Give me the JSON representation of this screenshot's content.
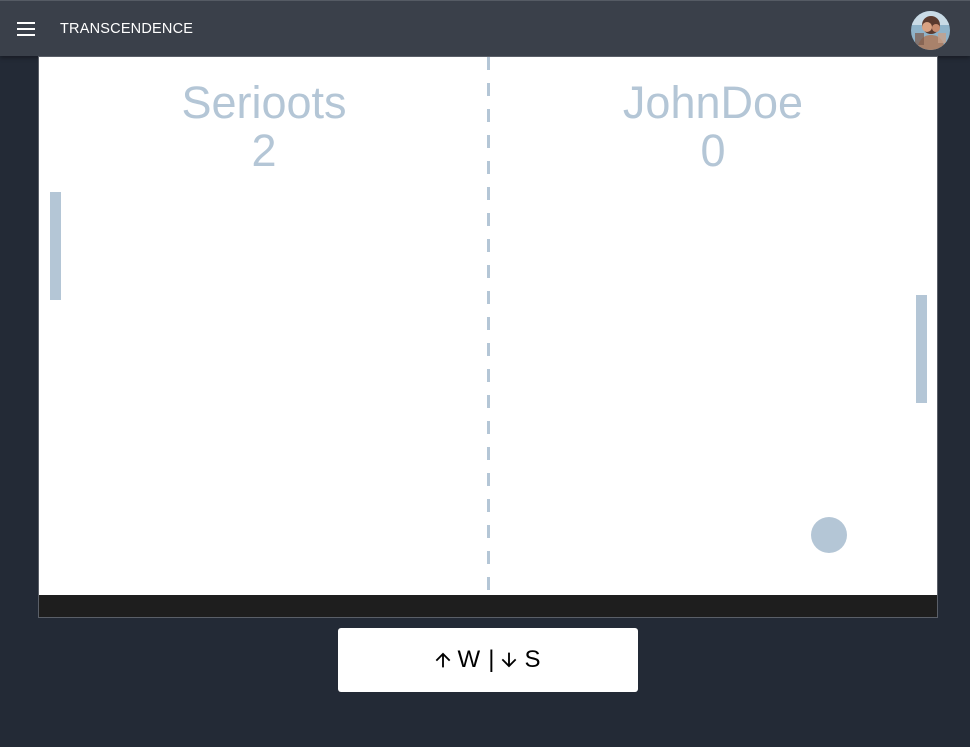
{
  "app": {
    "title": "TRANSCENDENCE",
    "menu_icon": "hamburger-menu-icon",
    "avatar_icon": "user-avatar"
  },
  "game": {
    "players": [
      {
        "name": "Serioots",
        "score": "2"
      },
      {
        "name": "JohnDoe",
        "score": "0"
      }
    ]
  },
  "controls": {
    "up_icon": "arrow-up-icon",
    "up_key": "W",
    "separator": "|",
    "down_icon": "arrow-down-icon",
    "down_key": "S"
  },
  "colors": {
    "page_background": "#232a36",
    "app_bar": "#3a404a",
    "court": "#ffffff",
    "game_elements": "#b4c6d6",
    "frame_bottom": "#1e1e1e"
  }
}
